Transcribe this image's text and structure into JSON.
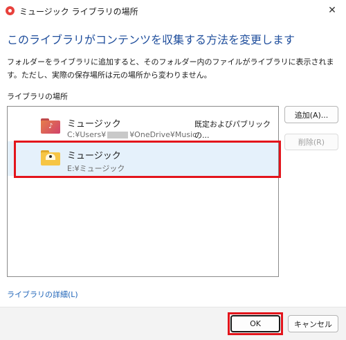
{
  "window": {
    "title": "ミュージック ライブラリの場所",
    "close_glyph": "✕"
  },
  "heading": "このライブラリがコンテンツを収集する方法を変更します",
  "description": "フォルダーをライブラリに追加すると、そのフォルダー内のファイルがライブラリに表示されます。ただし、実際の保存場所は元の場所から変わりません。",
  "section_label": "ライブラリの場所",
  "locations": [
    {
      "name": "ミュージック",
      "path_prefix": "C:¥Users¥",
      "path_suffix": "¥OneDrive¥Music",
      "status": "既定およびパブリックの...",
      "icon": "music-folder-icon"
    },
    {
      "name": "ミュージック",
      "path": "E:¥ミュージック",
      "icon": "folder-icon",
      "selected": true
    }
  ],
  "buttons": {
    "add": "追加(A)...",
    "remove": "削除(R)",
    "ok": "OK",
    "cancel": "キャンセル"
  },
  "details_link": "ライブラリの詳細(L)",
  "colors": {
    "highlight_border": "#e3141b",
    "selection_bg": "#e5f1fb",
    "heading": "#1f4e9c",
    "link": "#1f64b8"
  }
}
